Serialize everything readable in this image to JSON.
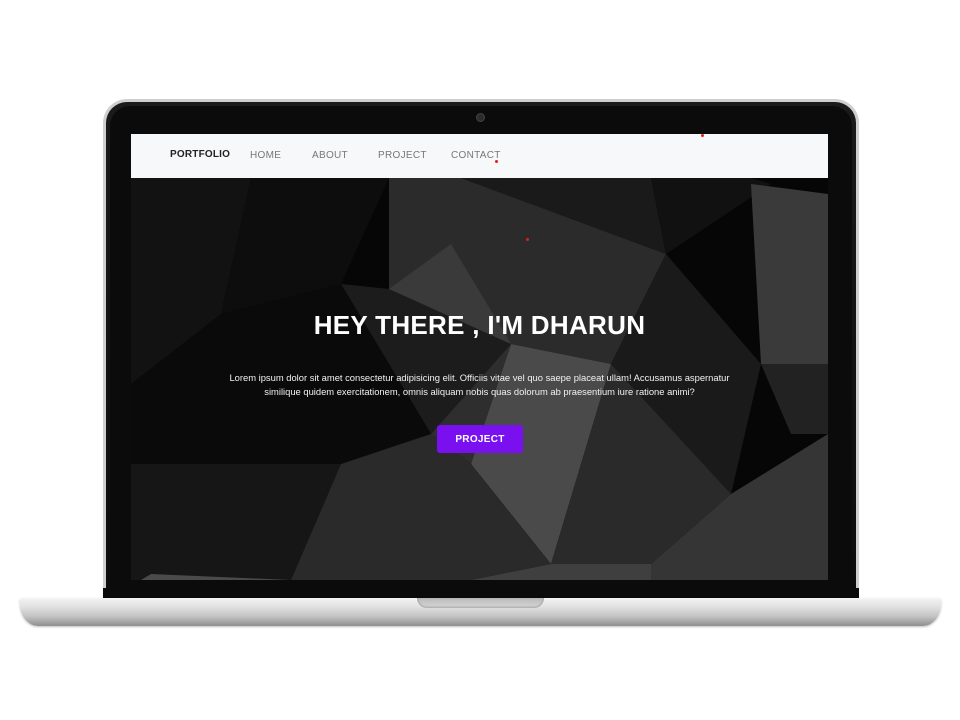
{
  "navbar": {
    "brand": "PORTFOLIO",
    "links": [
      "HOME",
      "ABOUT",
      "PROJECT",
      "CONTACT"
    ]
  },
  "hero": {
    "title": "HEY THERE , I'M DHARUN",
    "text": "Lorem ipsum dolor sit amet consectetur adipisicing elit. Officiis vitae vel quo saepe placeat ullam! Accusamus aspernatur similique quidem exercitationem, omnis aliquam nobis quas dolorum ab praesentium iure ratione animi?",
    "button_label": "PROJECT"
  },
  "colors": {
    "navbar_bg": "#f7f8f9",
    "button": "#7a10f0",
    "hero_bg": "#050505",
    "laptop_bezel": "#0b0b0b"
  },
  "icons": [
    "webcam-icon"
  ]
}
